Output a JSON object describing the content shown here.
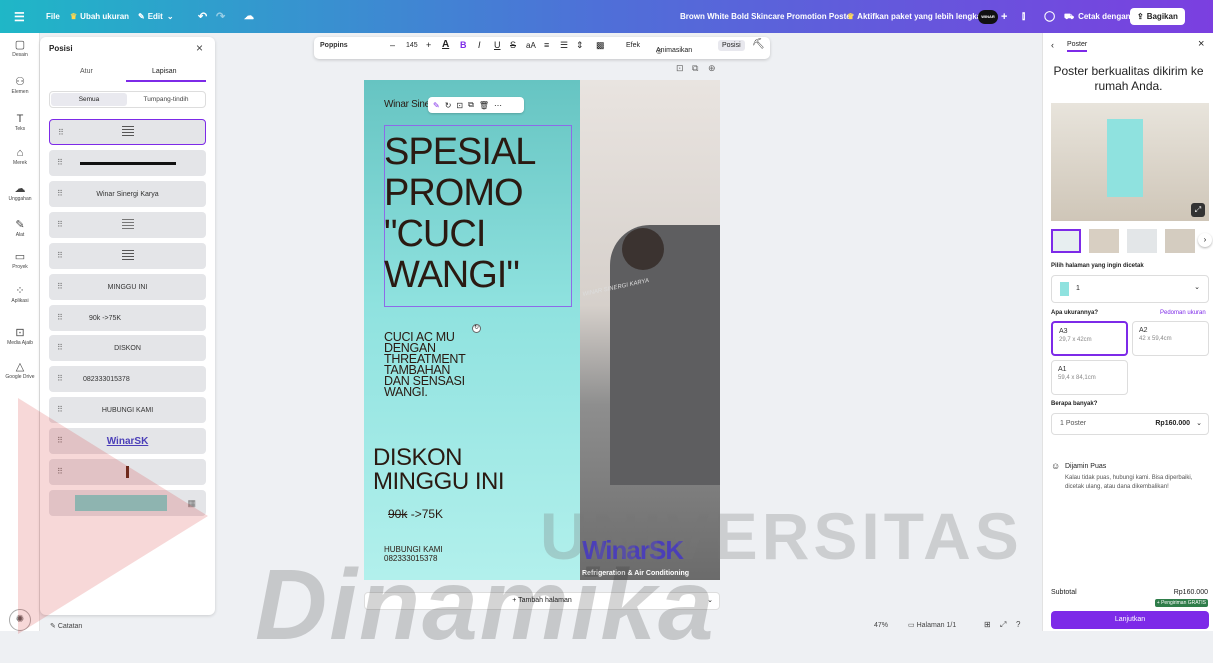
{
  "topbar": {
    "file": "File",
    "resize": "Ubah ukuran",
    "edit": "Edit",
    "doc_title": "Brown White Bold Skincare Promotion Poster",
    "upgrade": "Aktifkan paket yang lebih lengkap",
    "print": "Cetak dengan Canva",
    "share": "Bagikan"
  },
  "rail": [
    {
      "icon": "layout-icon",
      "label": "Desain"
    },
    {
      "icon": "elements-icon",
      "label": "Elemen"
    },
    {
      "icon": "text-icon",
      "label": "Teks"
    },
    {
      "icon": "brand-icon",
      "label": "Merek"
    },
    {
      "icon": "upload-icon",
      "label": "Unggahan"
    },
    {
      "icon": "draw-icon",
      "label": "Alat"
    },
    {
      "icon": "folder-icon",
      "label": "Proyek"
    },
    {
      "icon": "apps-icon",
      "label": "Aplikasi"
    },
    {
      "icon": "magic-media-icon",
      "label": "Media Ajaib"
    },
    {
      "icon": "drive-icon",
      "label": "Google Drive"
    }
  ],
  "panel": {
    "title": "Posisi",
    "tab_arrange": "Atur",
    "tab_layers": "Lapisan",
    "filter_all": "Semua",
    "filter_overlap": "Tumpang-tindih",
    "layers": [
      "",
      "",
      "Winar Sinergi Karya",
      "",
      "",
      "MINGGU INI",
      "90k ->75K",
      "DISKON",
      "082333015378",
      "HUBUNGI KAMI",
      "WinarSK",
      "",
      ""
    ]
  },
  "textbar": {
    "font": "Poppins",
    "size": "145",
    "effects": "Efek",
    "animate": "Animasikan",
    "position": "Posisi"
  },
  "poster": {
    "brand": "Winar Sinergi Karya",
    "headline": [
      "SPESIAL",
      "PROMO",
      "\"CUCI",
      "WANGI\""
    ],
    "body": [
      "CUCI AC MU",
      "DENGAN",
      "THREATMENT",
      "TAMBAHAN",
      "DAN SENSASI",
      "WANGI."
    ],
    "diskon": [
      "DISKON",
      "MINGGU INI"
    ],
    "price_old": "90k",
    "price_new": "->75K",
    "contact_label": "HUBUNGI KAMI",
    "phone": "082333015378",
    "logo": "WinarSK",
    "logo_tagline": "Refrigeration & Air Conditioning",
    "shirt_text": "WINAR SINERGI KARYA"
  },
  "add_page": "+ Tambah halaman",
  "bottom": {
    "notes": "Catatan",
    "zoom": "47%",
    "pages_label": "Halaman",
    "pages": "1/1"
  },
  "right": {
    "tab": "Poster",
    "headline": "Poster berkualitas dikirim ke rumah Anda.",
    "choose_page": "Pilih halaman yang ingin dicetak",
    "page_selected": "1",
    "size_q": "Apa ukurannya?",
    "size_guide": "Pedoman ukuran",
    "sizes": [
      {
        "name": "A3",
        "dim": "29,7 x 42cm"
      },
      {
        "name": "A2",
        "dim": "42 x 59,4cm"
      },
      {
        "name": "A1",
        "dim": "59,4 x 84,1cm"
      }
    ],
    "qty_q": "Berapa banyak?",
    "qty": "1 Poster",
    "price": "Rp160.000",
    "guarantee_title": "Dijamin Puas",
    "guarantee_text": "Kalau tidak puas, hubungi kami. Bisa diperbaiki, dicetak ulang, atau dana dikembalikan!",
    "subtotal_label": "Subtotal",
    "subtotal": "Rp160.000",
    "free_shipping": "+ Pengiriman GRATIS",
    "continue": "Lanjutkan"
  },
  "watermark": {
    "universitas": "UNIVERSITAS",
    "dinamika": "Dinamika"
  },
  "colors": {
    "accent": "#7d2ae8",
    "teal": "#1fb7c7",
    "poster_text": "#2a1a12"
  }
}
